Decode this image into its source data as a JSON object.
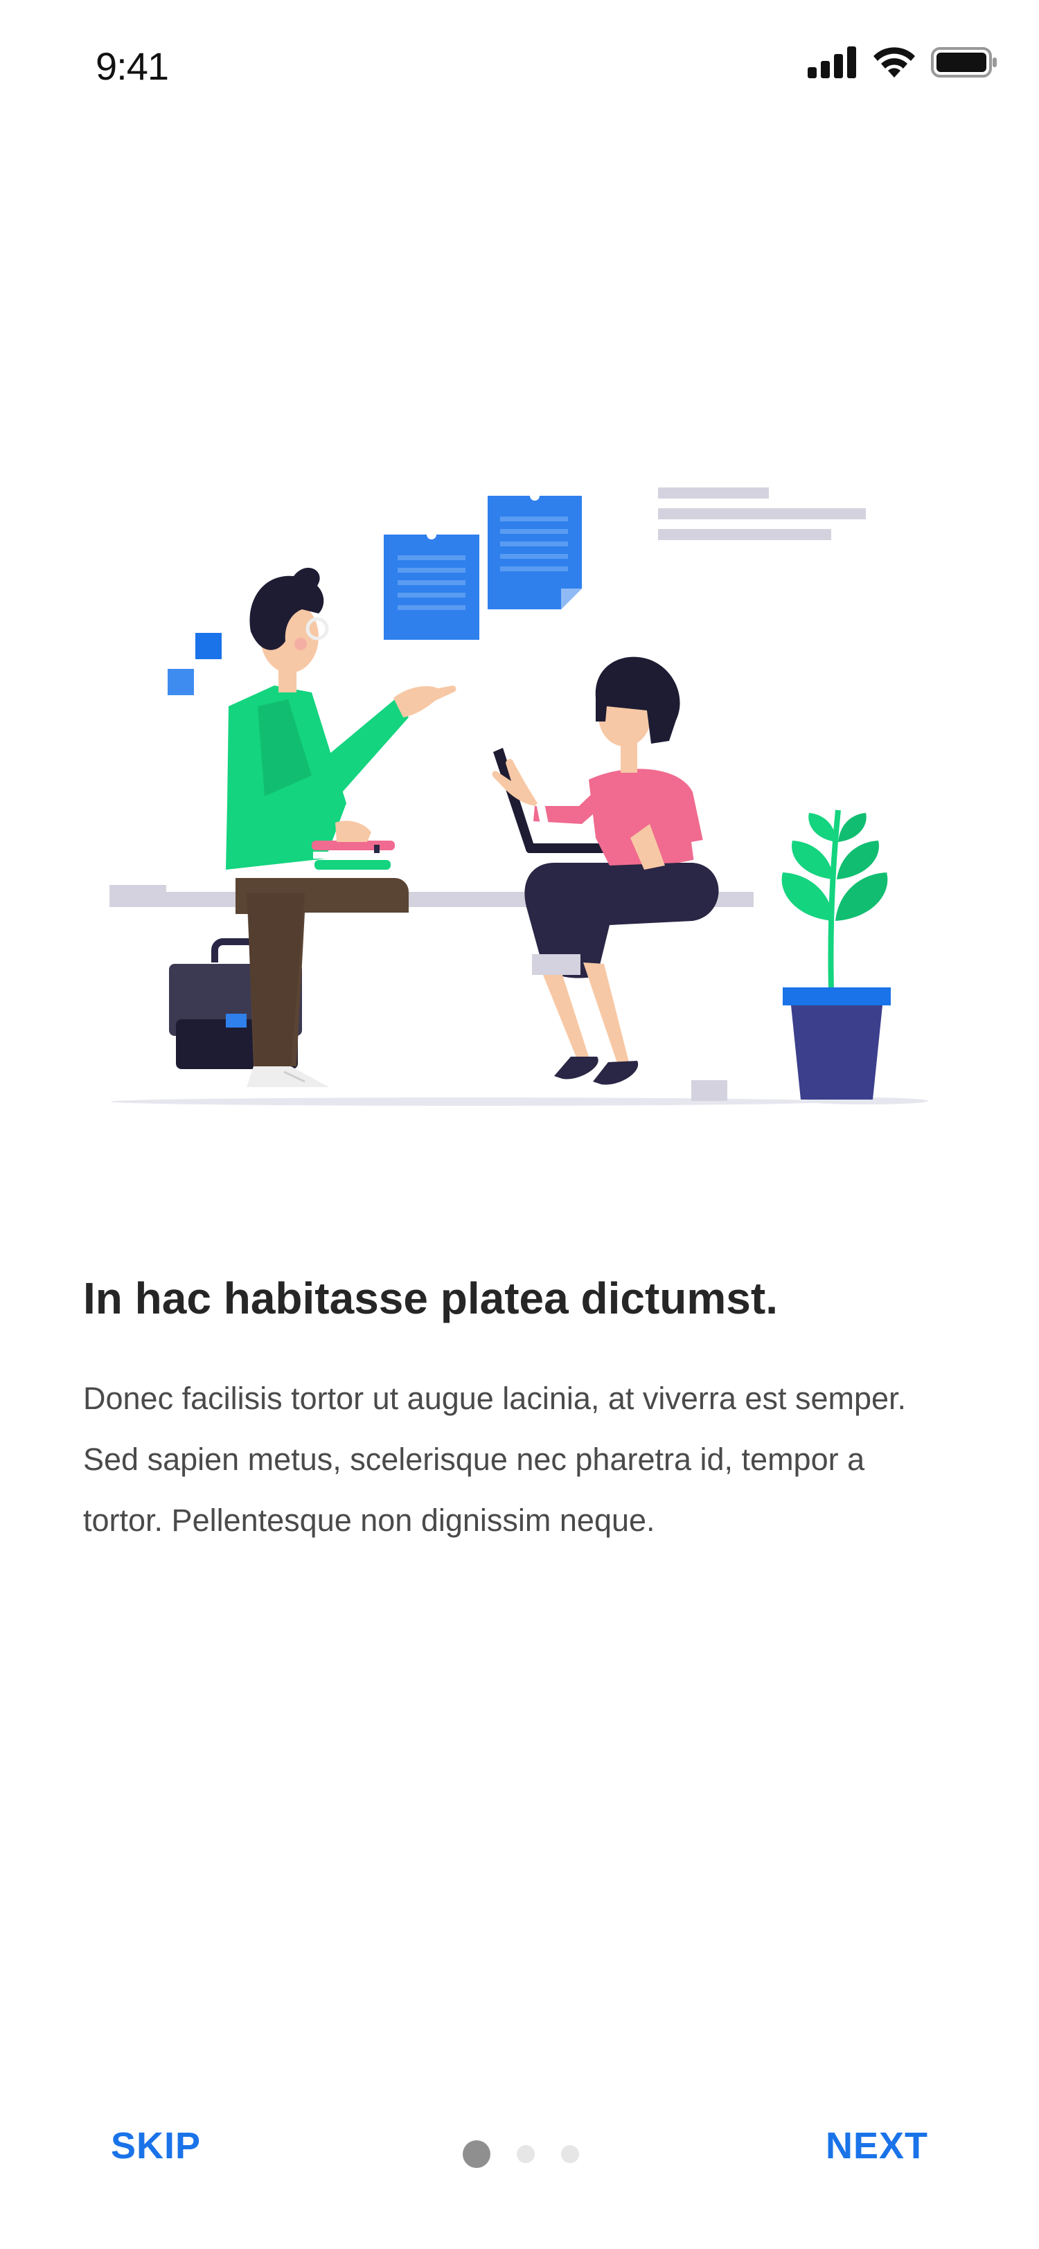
{
  "status_bar": {
    "time": "9:41",
    "icons": [
      "cellular-signal-icon",
      "wifi-icon",
      "battery-icon"
    ]
  },
  "illustration": {
    "description_icon": "onboarding-illustration",
    "colors": {
      "blue": "#2f80ed",
      "green": "#14d47f",
      "pink": "#f06b8f",
      "navy": "#2a2645",
      "brown": "#5a4434",
      "gray": "#d3d2de"
    }
  },
  "content": {
    "title": "In hac habitasse platea dictumst.",
    "body": "Donec facilisis tortor ut augue lacinia, at viverra est semper. Sed sapien metus, scelerisque nec pharetra id, tempor a tortor. Pellentesque non dignissim neque."
  },
  "navigation": {
    "skip_label": "SKIP",
    "next_label": "NEXT",
    "page_count": 3,
    "current_page": 1
  },
  "colors": {
    "accent": "#1a73e8",
    "dot_active": "#8f8f8f",
    "dot_inactive": "#e6e6e6"
  }
}
